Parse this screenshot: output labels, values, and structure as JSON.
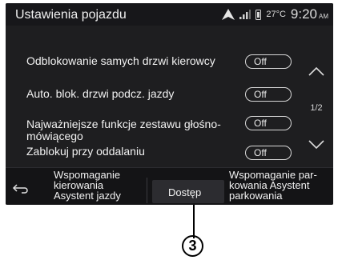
{
  "header": {
    "title": "Ustawienia pojazdu",
    "temperature": "27°C",
    "clock": "9:20",
    "clock_suffix": "AM",
    "icons": [
      "navigation-arrow-icon",
      "signal-icon",
      "phone-icon"
    ]
  },
  "settings": [
    {
      "label": "Odblokowanie samych drzwi kierowcy",
      "value": "Off"
    },
    {
      "label": "Auto. blok. drzwi podcz. jazdy",
      "value": "Off"
    },
    {
      "label": "Najważniejsze funkcje zestawu głośno-mówiącego",
      "value": "Off"
    },
    {
      "label": "Zablokuj przy oddalaniu",
      "value": "Off"
    }
  ],
  "pagination": {
    "indicator": "1/2"
  },
  "bottom_tabs": [
    {
      "label": "Wspomaganie kierowania Asystent jazdy"
    },
    {
      "label": "Dostęp",
      "active": true
    },
    {
      "label": "Wspomaganie par-kowania Asystent parkowania"
    }
  ],
  "callout": {
    "number": "3"
  },
  "colors": {
    "screen_bg": "#1e1e20",
    "text": "#f2f2f2",
    "active_tab": "#2c2c30"
  }
}
